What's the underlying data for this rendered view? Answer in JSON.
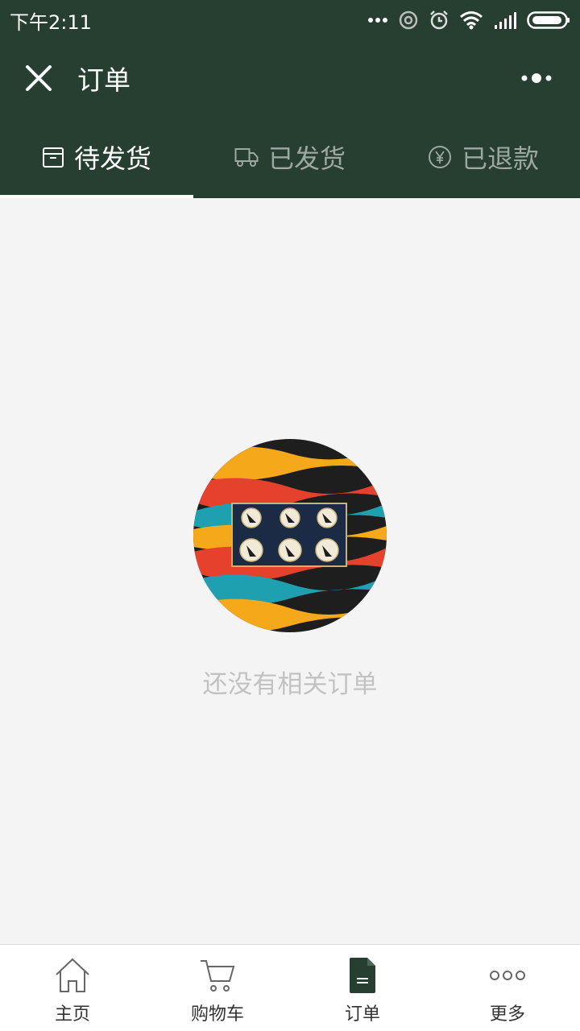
{
  "status_bar": {
    "time": "下午2:11",
    "icons": [
      "more-dots-icon",
      "hotspot-icon",
      "alarm-icon",
      "wifi-icon",
      "signal-icon",
      "battery-icon"
    ]
  },
  "nav": {
    "title": "订单",
    "close_icon": "close-icon",
    "more_icon": "more-icon"
  },
  "tabs": [
    {
      "label": "待发货",
      "icon": "package-icon",
      "active": true
    },
    {
      "label": "已发货",
      "icon": "truck-icon",
      "active": false
    },
    {
      "label": "已退款",
      "icon": "yen-icon",
      "active": false
    }
  ],
  "empty_state": {
    "message": "还没有相关订单"
  },
  "tabbar": {
    "items": [
      {
        "label": "主页",
        "icon": "home-icon",
        "active": false
      },
      {
        "label": "购物车",
        "icon": "cart-icon",
        "active": false
      },
      {
        "label": "订单",
        "icon": "document-icon",
        "active": true
      },
      {
        "label": "更多",
        "icon": "more-circles-icon",
        "active": false
      }
    ]
  },
  "colors": {
    "header_bg": "#263f30",
    "tab_inactive": "#9fa7a2",
    "content_bg": "#f4f4f4",
    "empty_text": "#c2c2c2"
  }
}
